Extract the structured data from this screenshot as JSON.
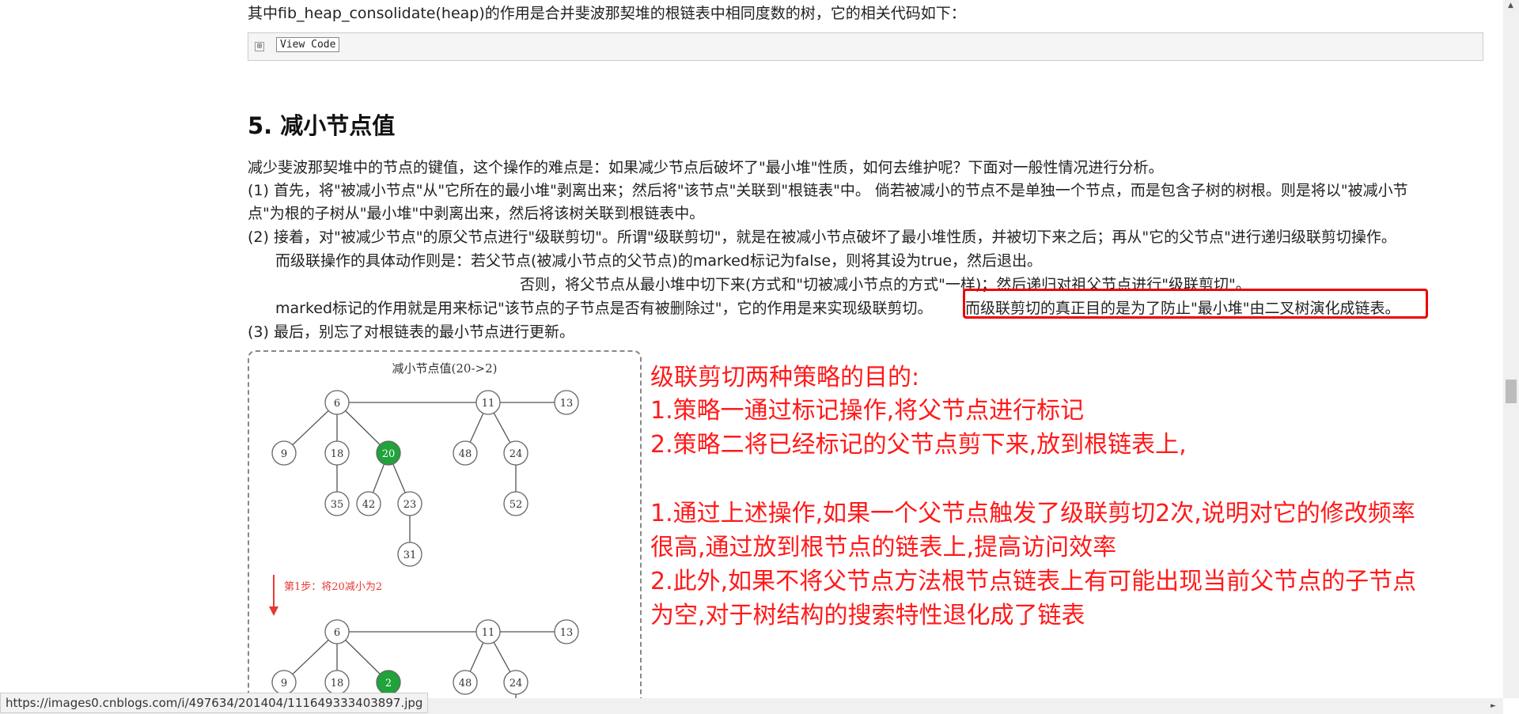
{
  "intro": "其中fib_heap_consolidate(heap)的作用是合并斐波那契堆的根链表中相同度数的树，它的相关代码如下：",
  "code_block": {
    "expand_symbol": "⊞",
    "view_code_label": "View Code"
  },
  "section_title": "5. 减小节点值",
  "paragraphs": [
    "减少斐波那契堆中的节点的键值，这个操作的难点是：如果减少节点后破坏了\"最小堆\"性质，如何去维护呢？下面对一般性情况进行分析。",
    "(1) 首先，将\"被减小节点\"从\"它所在的最小堆\"剥离出来；然后将\"该节点\"关联到\"根链表\"中。 倘若被减小的节点不是单独一个节点，而是包含子树的树根。则是将以\"被减小节",
    "点\"为根的子树从\"最小堆\"中剥离出来，然后将该树关联到根链表中。",
    "(2) 接着，对\"被减少节点\"的原父节点进行\"级联剪切\"。所谓\"级联剪切\"，就是在被减小节点破坏了最小堆性质，并被切下来之后；再从\"它的父节点\"进行递归级联剪切操作。",
    "而级联操作的具体动作则是：若父节点(被减小节点的父节点)的marked标记为false，则将其设为true，然后退出。",
    "否则，将父节点从最小堆中切下来(方式和\"切被减小节点的方式\"一样)；然后递归对祖父节点进行\"级联剪切\"。",
    "marked标记的作用就是用来标记\"该节点的子节点是否有被删除过\"，它的作用是来实现级联剪切。",
    "而级联剪切的真正目的是为了防止\"最小堆\"由二叉树演化成链表。",
    "(3) 最后，别忘了对根链表的最小节点进行更新。"
  ],
  "figure": {
    "title": "减小节点值(20->2)",
    "step_label": "第1步：将20减小为2",
    "tree1": [
      "6",
      "11",
      "13",
      "9",
      "18",
      "20",
      "48",
      "24",
      "35",
      "42",
      "23",
      "52",
      "31"
    ],
    "tree2": [
      "6",
      "11",
      "13",
      "9",
      "18",
      "2",
      "48",
      "24"
    ]
  },
  "notes": [
    "级联剪切两种策略的目的:",
    "1.策略一通过标记操作,将父节点进行标记",
    "2.策略二将已经标记的父节点剪下来,放到根链表上,",
    "1.通过上述操作,如果一个父节点触发了级联剪切2次,说明对它的修改频率",
    "很高,通过放到根节点的链表上,提高访问效率",
    "2.此外,如果不将父节点方法根节点链表上有可能出现当前父节点的子节点",
    "为空,对于树结构的搜索特性退化成了链表"
  ],
  "status_url": "https://images0.cnblogs.com/i/497634/201404/111649333403897.jpg",
  "colors": {
    "highlight_node": "#1fa33a",
    "annotation": "#ff1a1a",
    "box": "#e00000"
  }
}
